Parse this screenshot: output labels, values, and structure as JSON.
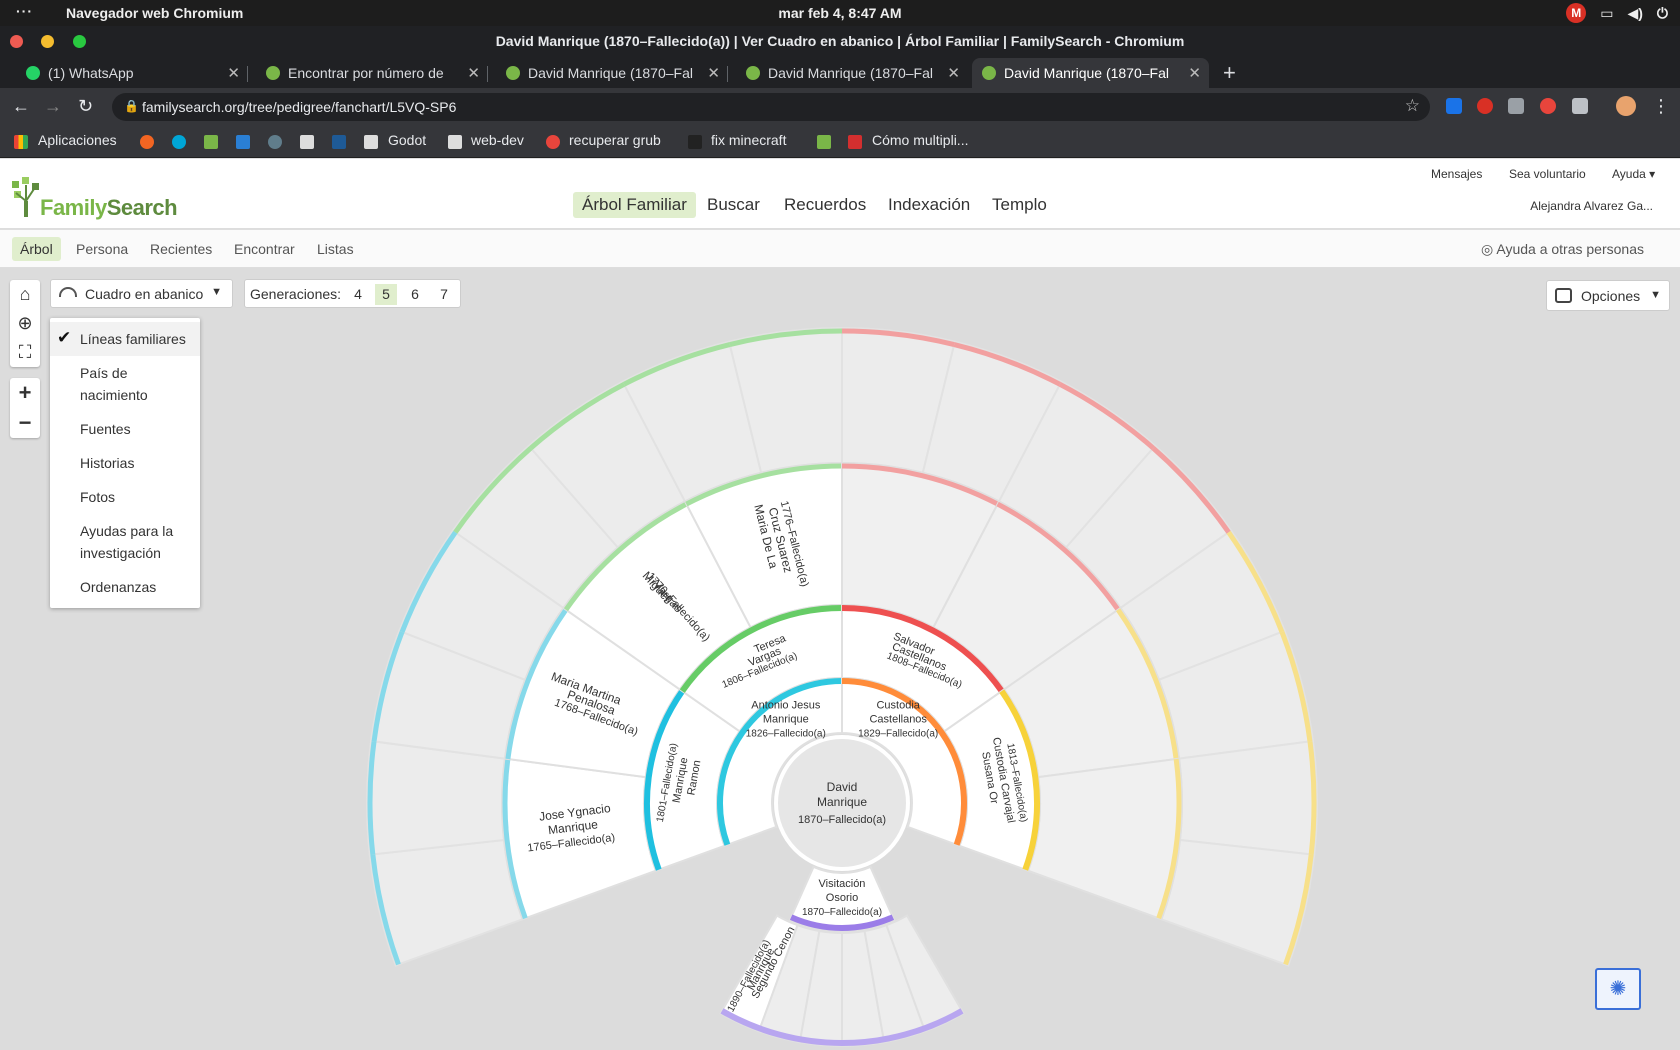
{
  "os": {
    "menu_dots": "···",
    "app_name": "Navegador web Chromium",
    "clock": "mar feb  4,  8:47 AM",
    "mail_badge": "M"
  },
  "window": {
    "title": "David Manrique (1870–Fallecido(a)) | Ver Cuadro en abanico | Árbol Familiar | FamilySearch - Chromium"
  },
  "tabs": [
    {
      "label": "(1) WhatsApp",
      "favicon_color": "#25d366"
    },
    {
      "label": "Encontrar por número de",
      "favicon_color": "#7ab648"
    },
    {
      "label": "David Manrique (1870–Fal",
      "favicon_color": "#7ab648"
    },
    {
      "label": "David Manrique (1870–Fal",
      "favicon_color": "#7ab648"
    },
    {
      "label": "David Manrique (1870–Fal",
      "favicon_color": "#7ab648"
    }
  ],
  "address_bar": {
    "url": "familysearch.org/tree/pedigree/fanchart/L5VQ-SP6"
  },
  "bookmarks": [
    {
      "label": "Aplicaciones",
      "icon": "apps-grid-icon"
    },
    {
      "label": "Godot",
      "icon": "folder-icon"
    },
    {
      "label": "web-dev",
      "icon": "folder-icon"
    },
    {
      "label": "recuperar grub",
      "icon": "ask-icon"
    },
    {
      "label": "fix minecraft",
      "icon": "minecraft-icon"
    },
    {
      "label": "Cómo multipli...",
      "icon": "site-icon"
    }
  ],
  "site": {
    "logo_text_a": "Family",
    "logo_text_b": "Search",
    "nav": [
      "Árbol Familiar",
      "Buscar",
      "Recuerdos",
      "Indexación",
      "Templo"
    ],
    "top_links": [
      "Mensajes",
      "Sea voluntario",
      "Ayuda ▾"
    ],
    "user_name": "Alejandra Alvarez Ga...",
    "subnav": [
      "Árbol",
      "Persona",
      "Recientes",
      "Encontrar",
      "Listas"
    ],
    "helpers": "Ayuda a otras personas"
  },
  "controls": {
    "view_select": "Cuadro en abanico",
    "generations_label": "Generaciones:",
    "generations": [
      "4",
      "5",
      "6",
      "7"
    ],
    "selected_generation": "5",
    "options_label": "Opciones"
  },
  "dropdown": {
    "items": [
      "Líneas familiares",
      "País de nacimiento",
      "Fuentes",
      "Historias",
      "Fotos",
      "Ayudas para la investigación",
      "Ordenanzas"
    ],
    "checked_item": "Líneas familiares"
  },
  "fan": {
    "root": {
      "name": "David Manrique",
      "dates": "1870–Fallecido(a)"
    },
    "people": [
      {
        "name": "Antonio Jesus Manrique",
        "dates": "1826–Fallecido(a)"
      },
      {
        "name": "Custodia Castellanos",
        "dates": "1829–Fallecido(a)"
      },
      {
        "name": "Ramon Manrique",
        "dates": "1801–Fallecido(a)"
      },
      {
        "name": "Teresa Vargas",
        "dates": "1806–Fallecido(a)"
      },
      {
        "name": "Salvador Castellanos",
        "dates": "1808–Fallecido(a)"
      },
      {
        "name": "Susana Or Custodia Carvajal",
        "dates": "1813–Fallecido(a)"
      },
      {
        "name": "Jose Ygnacio Manrique",
        "dates": "1765–Fallecido(a)"
      },
      {
        "name": "Maria Martina Penalosa",
        "dates": "1768–Fallecido(a)"
      },
      {
        "name": "Miguel Vargas",
        "dates": "1770–Fallecido(a)"
      },
      {
        "name": "Maria De La Cruz Suarez",
        "dates": "1776–Fallecido(a)"
      },
      {
        "name": "Visitación Osorio",
        "dates": "1870–Fallecido(a)"
      },
      {
        "name": "Segundo Cenon Manrique",
        "dates": "1890–Fallecido(a)"
      }
    ]
  }
}
